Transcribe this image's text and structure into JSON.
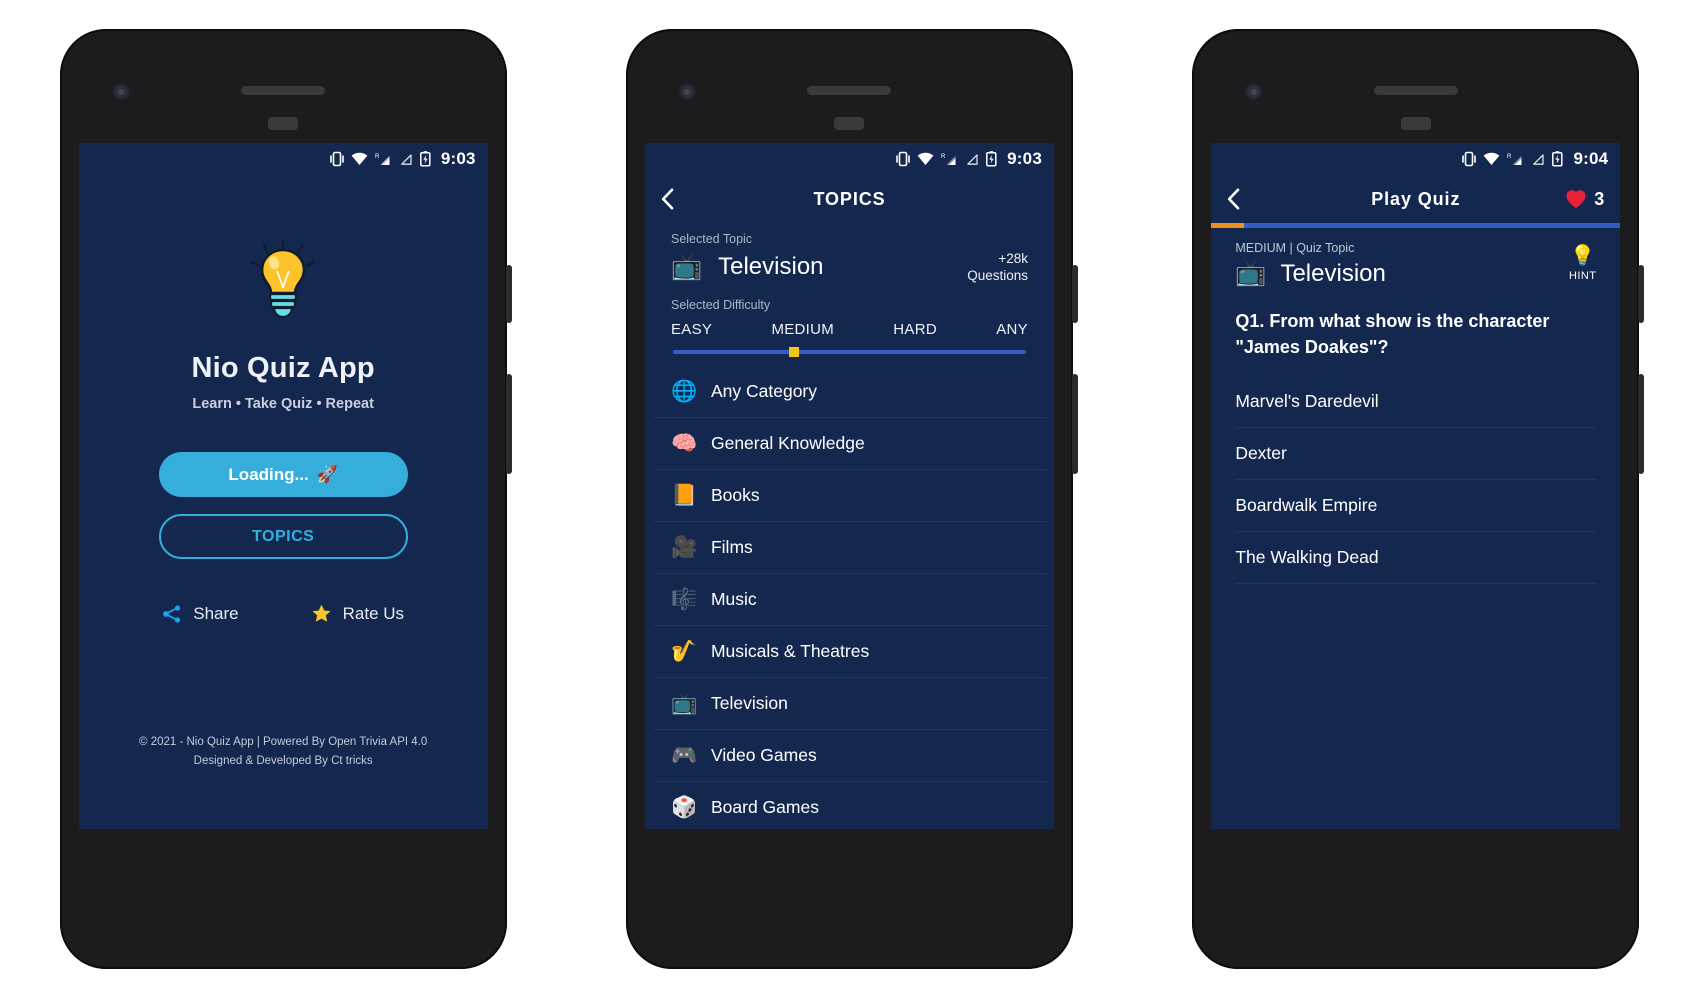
{
  "colors": {
    "screen_bg": "#14284f",
    "accent_cyan": "#35aedb",
    "accent_orange": "#f0901e",
    "accent_yellow": "#f5c518",
    "track_blue": "#2f5fc0",
    "phone_body": "#1c1c1e"
  },
  "phone1": {
    "statusbar": {
      "time": "9:03"
    },
    "logo_icon": "lightbulb-icon",
    "title": "Nio Quiz App",
    "tagline": "Learn • Take Quiz • Repeat",
    "loading_button": "Loading...",
    "loading_button_icon": "rocket-icon",
    "topics_button": "TOPICS",
    "quick_actions": [
      {
        "icon": "share-icon",
        "label": "Share"
      },
      {
        "icon": "star-icon",
        "label": "Rate Us"
      }
    ],
    "footer_line1": "© 2021 - Nio Quiz App | Powered By Open Trivia API 4.0",
    "footer_line2": "Designed & Developed By Ct tricks"
  },
  "phone2": {
    "statusbar": {
      "time": "9:03"
    },
    "appbar": {
      "back_icon": "chevron-left-icon",
      "title": "TOPICS"
    },
    "selected_topic_label": "Selected Topic",
    "selected_topic_icon": "television-icon",
    "selected_topic": "Television",
    "question_count_line1": "+28k",
    "question_count_line2": "Questions",
    "selected_difficulty_label": "Selected Difficulty",
    "difficulties": [
      "EASY",
      "MEDIUM",
      "HARD",
      "ANY"
    ],
    "difficulty_selected": "MEDIUM",
    "slider_percent": 33,
    "categories": [
      {
        "icon": "globe-icon",
        "glyph": "🌐",
        "label": "Any Category"
      },
      {
        "icon": "brain-icon",
        "glyph": "🧠",
        "label": "General Knowledge"
      },
      {
        "icon": "book-icon",
        "glyph": "📙",
        "label": "Books"
      },
      {
        "icon": "film-camera-icon",
        "glyph": "🎥",
        "label": "Films"
      },
      {
        "icon": "music-score-icon",
        "glyph": "🎼",
        "label": "Music"
      },
      {
        "icon": "saxophone-icon",
        "glyph": "🎷",
        "label": "Musicals & Theatres"
      },
      {
        "icon": "television-icon",
        "glyph": "📺",
        "label": "Television"
      },
      {
        "icon": "video-game-icon",
        "glyph": "🎮",
        "label": "Video Games"
      },
      {
        "icon": "dice-icon",
        "glyph": "🎲",
        "label": "Board Games"
      }
    ]
  },
  "phone3": {
    "statusbar": {
      "time": "9:04"
    },
    "appbar": {
      "back_icon": "chevron-left-icon",
      "title": "Play Quiz",
      "lives_icon": "heart-icon",
      "lives": "3"
    },
    "progress_percent": 8,
    "meta": "MEDIUM | Quiz Topic",
    "topic_icon": "television-icon",
    "topic": "Television",
    "hint_icon": "lightbulb-icon",
    "hint_label": "HINT",
    "question": "Q1. From what show is the character \"James Doakes\"?",
    "options": [
      "Marvel's Daredevil",
      "Dexter",
      "Boardwalk Empire",
      "The Walking Dead"
    ]
  }
}
